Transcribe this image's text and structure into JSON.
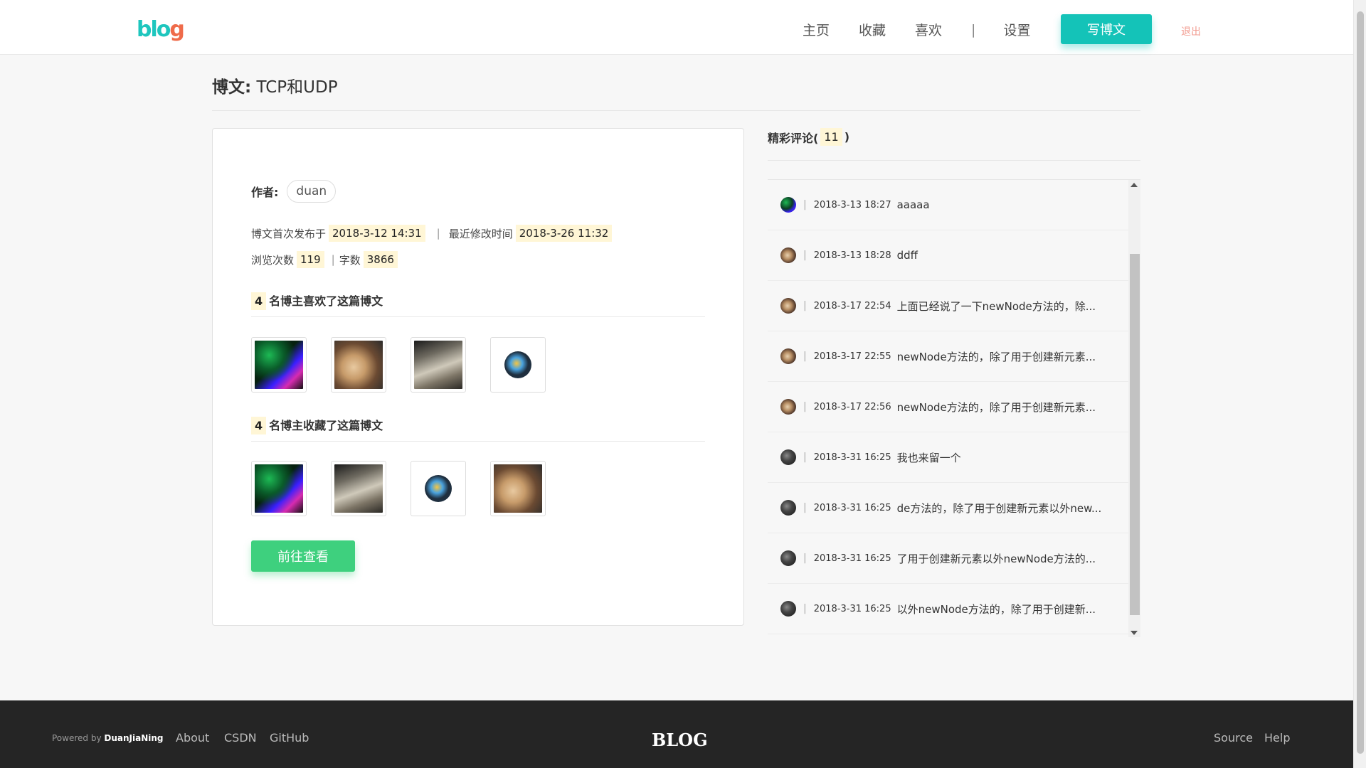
{
  "header": {
    "logo": {
      "b": "bl",
      "o": "o",
      "g": "g"
    },
    "nav": [
      "主页",
      "收藏",
      "喜欢"
    ],
    "nav_sep": "|",
    "settings": "设置",
    "write_button": "写博文",
    "logout": "退出"
  },
  "page": {
    "title_label": "博文:",
    "title": "TCP和UDP"
  },
  "article": {
    "author_label": "作者:",
    "author": "duan",
    "published_label": "博文首次发布于",
    "published": "2018-3-12 14:31",
    "modified_label": "最近修改时间",
    "modified": "2018-3-26 11:32",
    "views_label": "浏览次数",
    "views": "119",
    "words_label": "字数",
    "words": "3866",
    "likes_count": "4",
    "likes_text": "名博主喜欢了这篇博文",
    "collects_count": "4",
    "collects_text": "名博主收藏了这篇博文",
    "view_button": "前往查看"
  },
  "comments": {
    "title": "精彩评论(",
    "count": "11",
    "title_close": ")",
    "items": [
      {
        "time": "2018-3-13 18:27",
        "text": "aaaaa",
        "avatar": "neon"
      },
      {
        "time": "2018-3-13 18:28",
        "text": "ddff",
        "avatar": "dog"
      },
      {
        "time": "2018-3-17 22:54",
        "text": "上面已经说了一下newNode方法的，除...",
        "avatar": "dog"
      },
      {
        "time": "2018-3-17 22:55",
        "text": "newNode方法的，除了用于创建新元素...",
        "avatar": "dog"
      },
      {
        "time": "2018-3-17 22:56",
        "text": "newNode方法的，除了用于创建新元素...",
        "avatar": "dog"
      },
      {
        "time": "2018-3-31 16:25",
        "text": "我也来留一个",
        "avatar": "dark"
      },
      {
        "time": "2018-3-31 16:25",
        "text": "de方法的，除了用于创建新元素以外new...",
        "avatar": "dark"
      },
      {
        "time": "2018-3-31 16:25",
        "text": "了用于创建新元素以外newNode方法的...",
        "avatar": "dark"
      },
      {
        "time": "2018-3-31 16:25",
        "text": "以外newNode方法的，除了用于创建新...",
        "avatar": "dark"
      }
    ]
  },
  "footer": {
    "powered_by": "Powered by",
    "powered_name": "DuanJiaNing",
    "about": "About",
    "csdn": "CSDN",
    "github": "GitHub",
    "brand": "BLOG",
    "source": "Source",
    "help": "Help"
  },
  "colors": {
    "accent": "#14c3b8",
    "green": "#3ed07e",
    "logout": "#f29b8f",
    "highlight": "#fff6d6",
    "footer_bg": "#252525"
  }
}
